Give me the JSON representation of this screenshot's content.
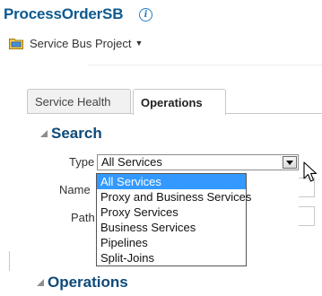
{
  "header": {
    "title": "ProcessOrderSB",
    "info_icon": "info-icon",
    "project_icon": "folder-icon",
    "project_label": "Service Bus Project",
    "project_caret": "▼"
  },
  "tabs": [
    {
      "label": "Service Health",
      "active": false
    },
    {
      "label": "Operations",
      "active": true
    }
  ],
  "search": {
    "title": "Search",
    "fields": {
      "type_label": "Type",
      "type_value": "All Services",
      "name_label": "Name",
      "path_label": "Path"
    },
    "dropdown_options": [
      "All Services",
      "Proxy and Business Services",
      "Proxy Services",
      "Business Services",
      "Pipelines",
      "Split-Joins"
    ],
    "selected_index": 0
  },
  "operations": {
    "title": "Operations"
  },
  "colors": {
    "title": "#0e5a8f",
    "section": "#0e4a7a",
    "selection": "#3399ff"
  }
}
